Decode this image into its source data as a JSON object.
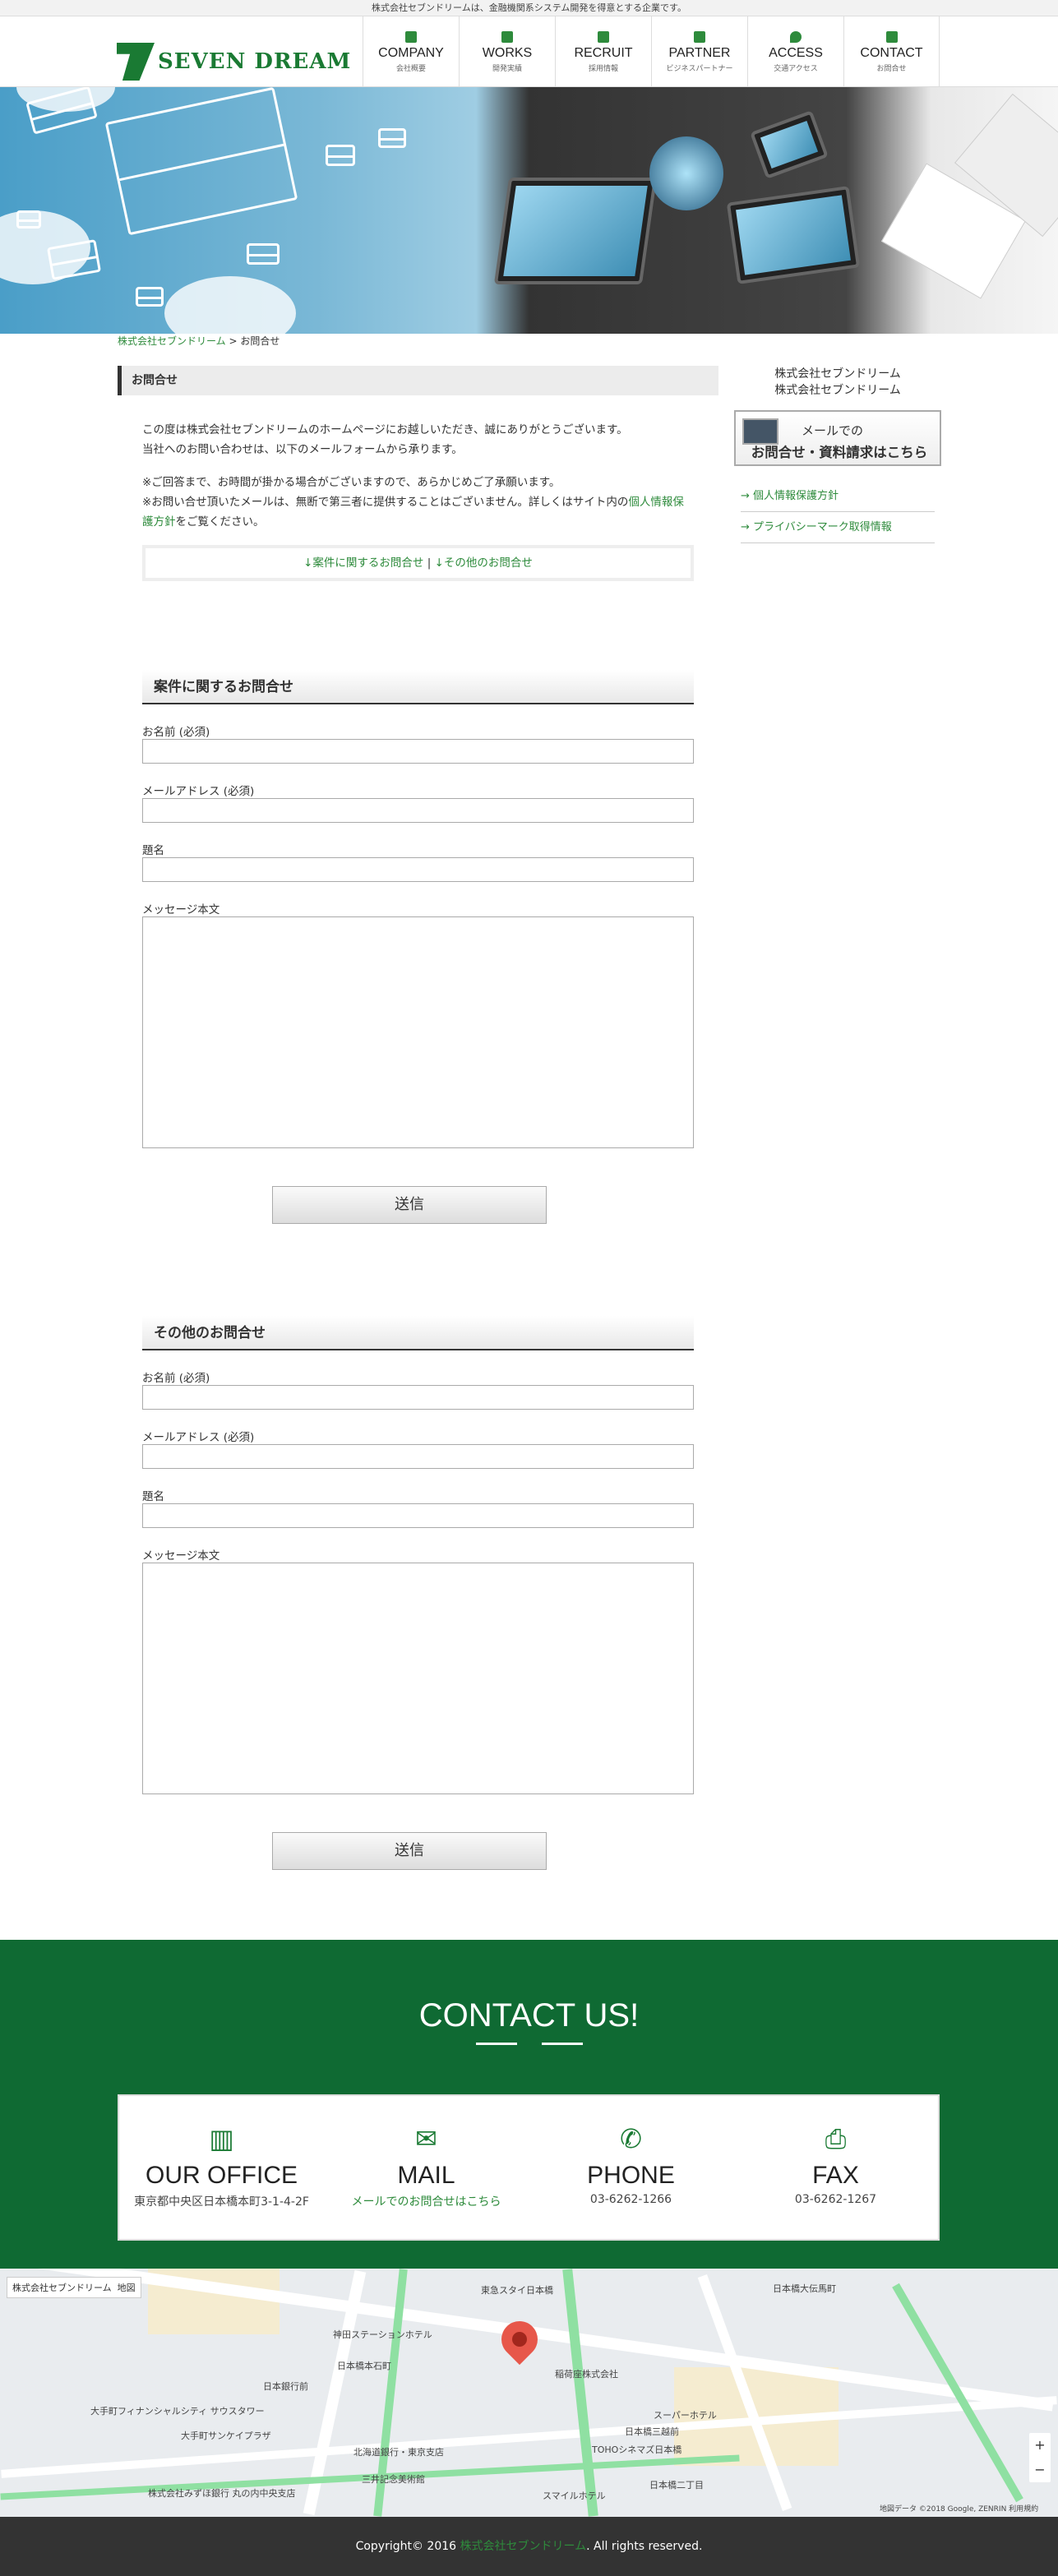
{
  "topbar": {
    "text": "株式会社セブンドリームは、金融機関系システム開発を得意とする企業です。"
  },
  "logo": {
    "name": "SEVEN DREAM"
  },
  "nav": [
    {
      "en": "COMPANY",
      "jp": "会社概要"
    },
    {
      "en": "WORKS",
      "jp": "開発実績"
    },
    {
      "en": "RECRUIT",
      "jp": "採用情報"
    },
    {
      "en": "PARTNER",
      "jp": "ビジネスパートナー"
    },
    {
      "en": "ACCESS",
      "jp": "交通アクセス"
    },
    {
      "en": "CONTACT",
      "jp": "お問合せ"
    }
  ],
  "breadcrumb": {
    "home": "株式会社セブンドリーム",
    "sep": ">",
    "current": "お問合せ"
  },
  "page": {
    "title": "お問合せ",
    "p1": "この度は株式会社セブンドリームのホームページにお越しいただき、誠にありがとうございます。",
    "p2": "当社へのお問い合わせは、以下のメールフォームから承ります。",
    "p3": "※ご回答まで、お時間が掛かる場合がございますので、あらかじめご了承願います。",
    "p4": "※お問い合せ頂いたメールは、無断で第三者に提供することはございません。詳しくはサイト内の",
    "p4link": "個人情報保護方針",
    "p4end": "をご覧ください。",
    "anchor1": "↓案件に関するお問合せ",
    "anchor_sep": "|",
    "anchor2": "↓その他のお問合せ"
  },
  "form1": {
    "heading": "案件に関するお問合せ",
    "name": "お名前 (必須)",
    "email": "メールアドレス (必須)",
    "subject": "題名",
    "message": "メッセージ本文",
    "submit": "送信"
  },
  "form2": {
    "heading": "その他のお問合せ",
    "name": "お名前 (必須)",
    "email": "メールアドレス (必須)",
    "subject": "題名",
    "message": "メッセージ本文",
    "submit": "送信"
  },
  "sidebar": {
    "company1": "株式会社セブンドリーム",
    "company2": "株式会社セブンドリーム",
    "banner_l1": "メールでの",
    "banner_l2": "お問合せ・資料請求はこちら",
    "links": [
      "→ 個人情報保護方針",
      "→ プライバシーマーク取得情報"
    ]
  },
  "contact": {
    "title": "CONTACT US!",
    "office": {
      "title": "OUR OFFICE",
      "sub": "東京都中央区日本橋本町3-1-4-2F"
    },
    "mail": {
      "title": "MAIL",
      "sub": "メールでのお問合せはこちら"
    },
    "phone": {
      "title": "PHONE",
      "sub": "03-6262-1266"
    },
    "fax": {
      "title": "FAX",
      "sub": "03-6262-1267"
    }
  },
  "map": {
    "label": "株式会社セブンドリーム",
    "tab": "地図",
    "labels": [
      "東急スタイ日本橋",
      "神田ステーションホテル",
      "稲荷座株式会社",
      "日本橋本石町",
      "スーパーホテル",
      "日本橋大伝馬町",
      "大手町フィナンシャルシティ サウスタワー",
      "大手町サンケイプラザ",
      "北海道銀行・東京支店",
      "三井記念美術館",
      "日本橋三越前",
      "TOHOシネマズ日本橋",
      "日本銀行前",
      "スマイルホテル",
      "日本橋二丁目",
      "株式会社みずほ銀行 丸の内中央支店"
    ],
    "copyright": "地図データ ©2018 Google, ZENRIN   利用規約"
  },
  "footer": {
    "pre": "Copyright© 2016 ",
    "link": "株式会社セブンドリーム",
    "post": ". All rights reserved."
  },
  "colors": {
    "brand": "#1a7a33",
    "contact_bg": "#0f6a33",
    "link": "#2e8b3c"
  }
}
